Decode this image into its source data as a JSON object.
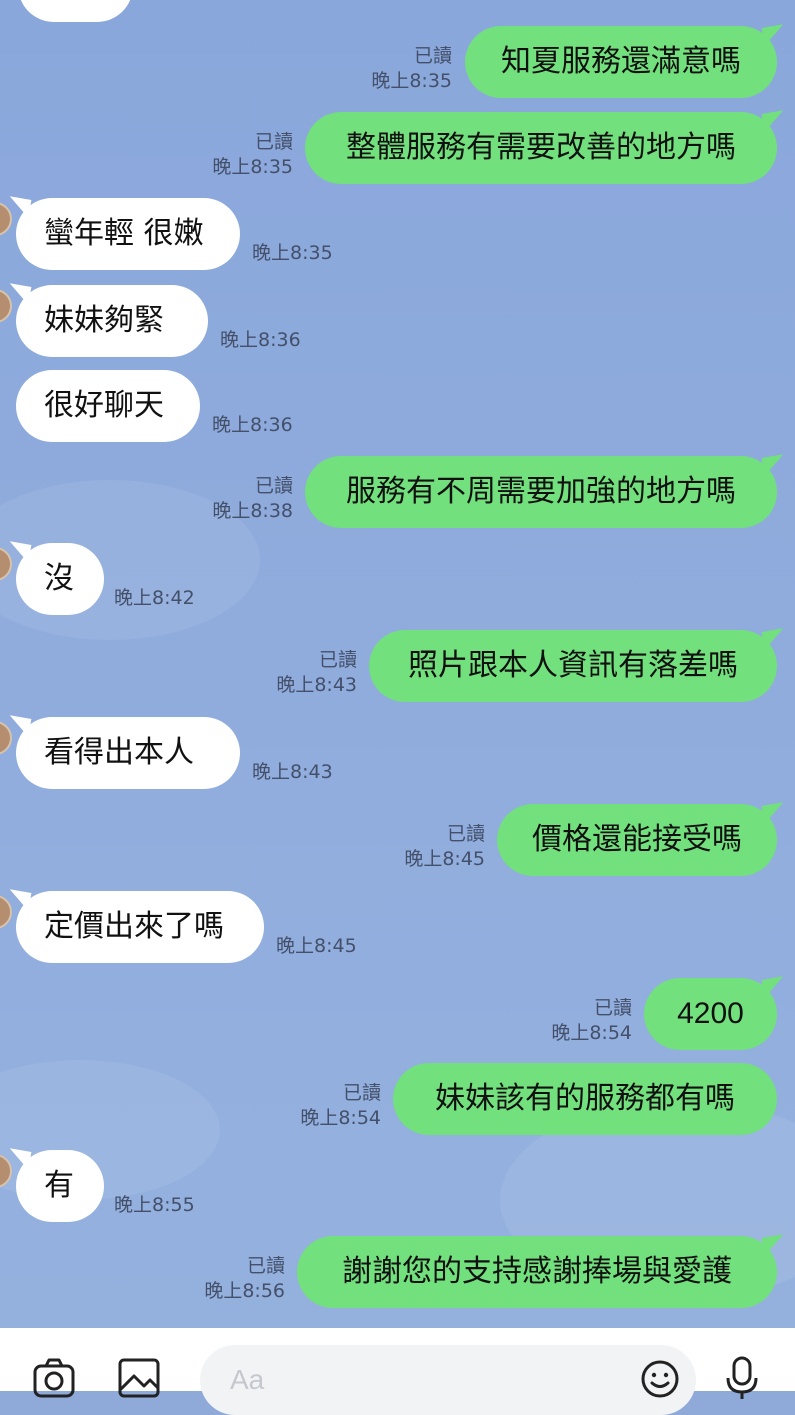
{
  "chat": {
    "read_label": "已讀",
    "messages": [
      {
        "dir": "out",
        "text": "知夏服務還滿意嗎",
        "time": "晚上8:35"
      },
      {
        "dir": "out",
        "text": "整體服務有需要改善的地方嗎",
        "time": "晚上8:35"
      },
      {
        "dir": "in",
        "text": "蠻年輕 很嫩",
        "time": "晚上8:35"
      },
      {
        "dir": "in",
        "text": "妹妹夠緊",
        "time": "晚上8:36"
      },
      {
        "dir": "in",
        "text": "很好聊天",
        "time": "晚上8:36"
      },
      {
        "dir": "out",
        "text": "服務有不周需要加強的地方嗎",
        "time": "晚上8:38"
      },
      {
        "dir": "in",
        "text": "沒",
        "time": "晚上8:42"
      },
      {
        "dir": "out",
        "text": "照片跟本人資訊有落差嗎",
        "time": "晚上8:43"
      },
      {
        "dir": "in",
        "text": "看得出本人",
        "time": "晚上8:43"
      },
      {
        "dir": "out",
        "text": "價格還能接受嗎",
        "time": "晚上8:45"
      },
      {
        "dir": "in",
        "text": "定價出來了嗎",
        "time": "晚上8:45"
      },
      {
        "dir": "out",
        "text": "4200",
        "time": "晚上8:54"
      },
      {
        "dir": "out",
        "text": "妹妹該有的服務都有嗎",
        "time": "晚上8:54"
      },
      {
        "dir": "in",
        "text": "有",
        "time": "晚上8:55"
      },
      {
        "dir": "out",
        "text": "謝謝您的支持感謝捧場與愛護",
        "time": "晚上8:56"
      }
    ]
  },
  "toolbar": {
    "input_placeholder": "Aa",
    "icons": [
      "camera-icon",
      "image-icon",
      "emoji-icon",
      "microphone-icon"
    ]
  },
  "colors": {
    "background": "#8aa7db",
    "outgoing_bubble": "#72e07d",
    "incoming_bubble": "#ffffff"
  }
}
